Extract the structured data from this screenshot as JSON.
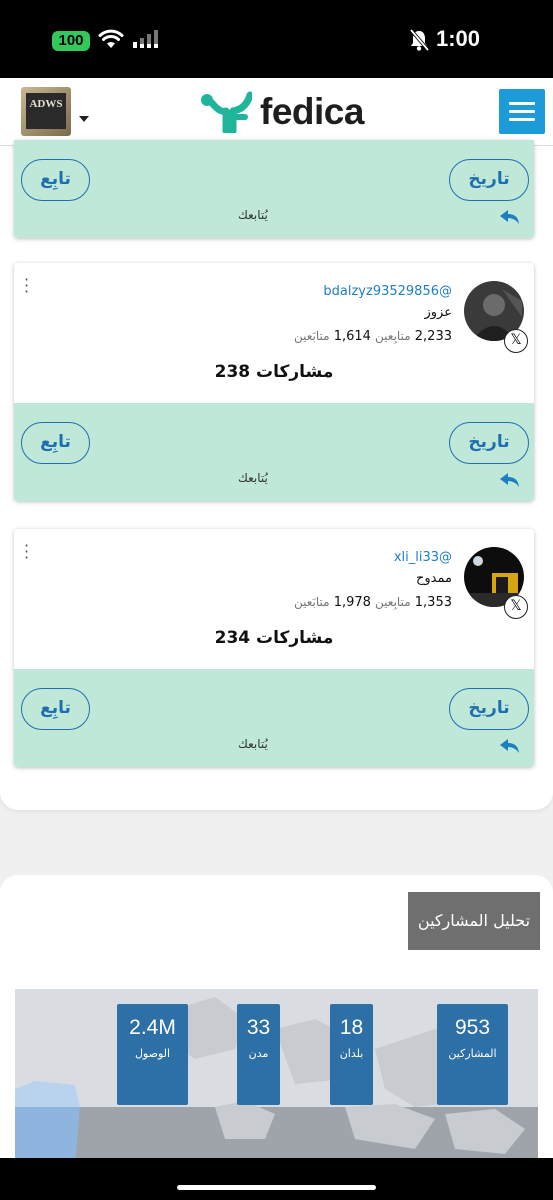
{
  "status_bar": {
    "battery": "100",
    "time": "1:00"
  },
  "header": {
    "brand": "fedica",
    "account_logo_text": "ADWS"
  },
  "cards": [
    {
      "follow_label": "تابِع",
      "history_label": "تاريخ",
      "follows_you": "يُتابعك"
    },
    {
      "handle": "bdalzyz93529856@",
      "name": "عزوز",
      "followers_count": "2,233",
      "followers_label": "متابِعين",
      "following_count": "1,614",
      "following_label": "متابَعين",
      "posts": "238 مشاركات",
      "follow_label": "تابِع",
      "history_label": "تاريخ",
      "follows_you": "يُتابعك",
      "platform_icon": "x-icon"
    },
    {
      "handle": "xli_li33@",
      "name": "ممدوح",
      "followers_count": "1,353",
      "followers_label": "متابِعين",
      "following_count": "1,978",
      "following_label": "متابَعين",
      "posts": "234 مشاركات",
      "follow_label": "تابِع",
      "history_label": "تاريخ",
      "follows_you": "يُتابعك",
      "platform_icon": "x-icon"
    }
  ],
  "analysis": {
    "title": "تحليل المشاركين",
    "stats": [
      {
        "value": "953",
        "label": "المشاركين"
      },
      {
        "value": "18",
        "label": "بلدان"
      },
      {
        "value": "33",
        "label": "مدن"
      },
      {
        "value": "2.4M",
        "label": "الوصول"
      }
    ]
  },
  "colors": {
    "brand": "#1fb59a",
    "accent": "#1d9bd8",
    "card_footer": "#bfe8d9",
    "stat_box": "#2d6fa7"
  }
}
